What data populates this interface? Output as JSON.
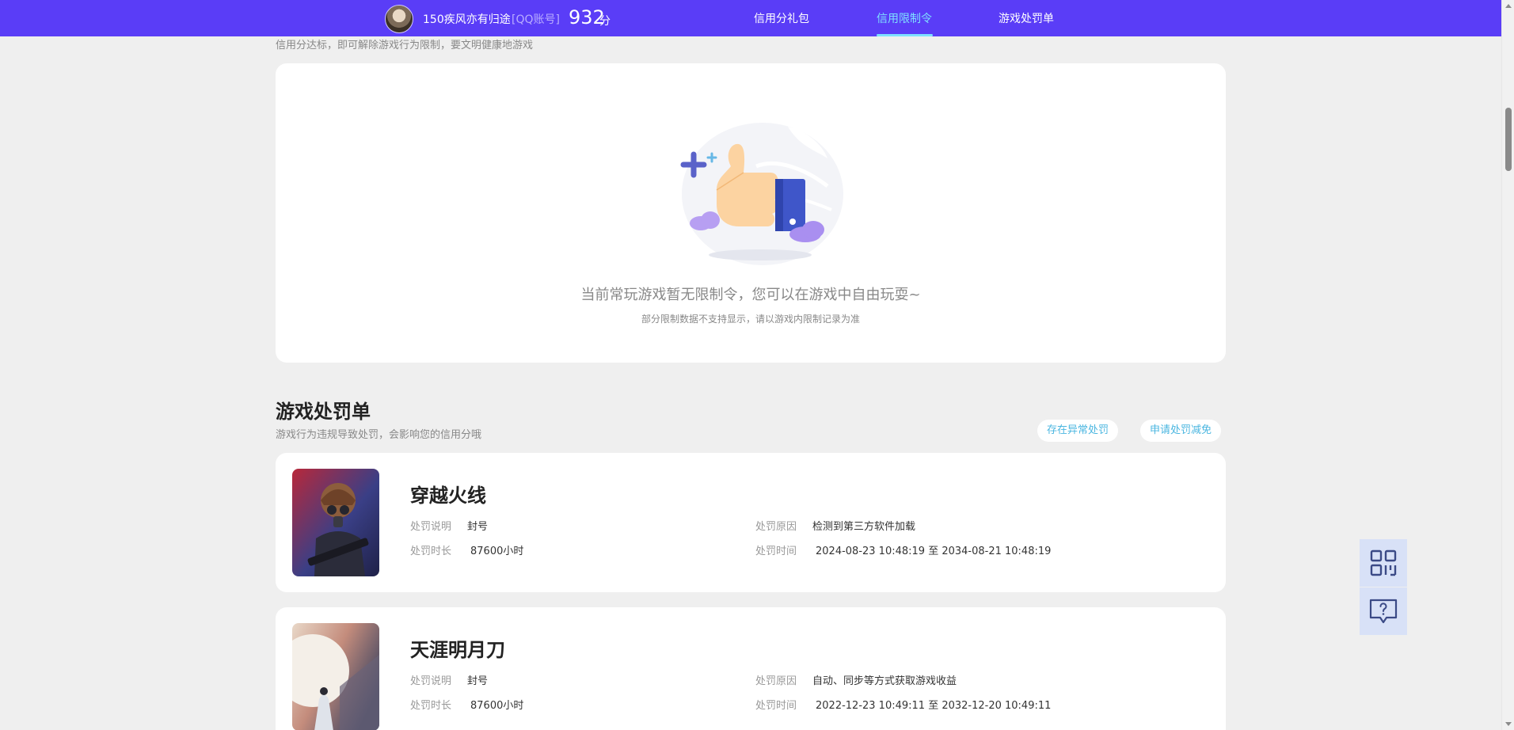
{
  "header": {
    "username": "150疾风亦有归途",
    "account_type": "[QQ账号]",
    "score": "932",
    "score_unit": "分",
    "nav": [
      {
        "label": "信用分礼包",
        "active": false
      },
      {
        "label": "信用限制令",
        "active": true
      },
      {
        "label": "游戏处罚单",
        "active": false
      }
    ]
  },
  "restriction": {
    "note": "信用分达标，即可解除游戏行为限制，要文明健康地游戏",
    "empty_title": "当前常玩游戏暂无限制令，您可以在游戏中自由玩耍~",
    "empty_sub": "部分限制数据不支持显示，请以游戏内限制记录为准"
  },
  "penalties": {
    "title": "游戏处罚单",
    "subtitle": "游戏行为违规导致处罚，会影响您的信用分哦",
    "buttons": {
      "abnormal": "存在异常处罚",
      "appeal": "申请处罚减免"
    },
    "labels": {
      "desc": "处罚说明",
      "duration": "处罚时长",
      "reason": "处罚原因",
      "time": "处罚时间"
    },
    "items": [
      {
        "game": "穿越火线",
        "desc": "封号",
        "duration": "87600小时",
        "reason": "检测到第三方软件加载",
        "time": "2024-08-23 10:48:19 至 2034-08-21 10:48:19"
      },
      {
        "game": "天涯明月刀",
        "desc": "封号",
        "duration": "87600小时",
        "reason": "自动、同步等方式获取游戏收益",
        "time": "2022-12-23 10:49:11 至 2032-12-20 10:49:11"
      }
    ]
  },
  "colors": {
    "header_bg": "#5a3df7",
    "active_nav": "#7ee0ff",
    "pill_text": "#4ab6e0",
    "side_tool_bg": "#d8e1f7"
  },
  "icons": {
    "side_tools": [
      "qr-code-icon",
      "help-chat-icon"
    ]
  }
}
